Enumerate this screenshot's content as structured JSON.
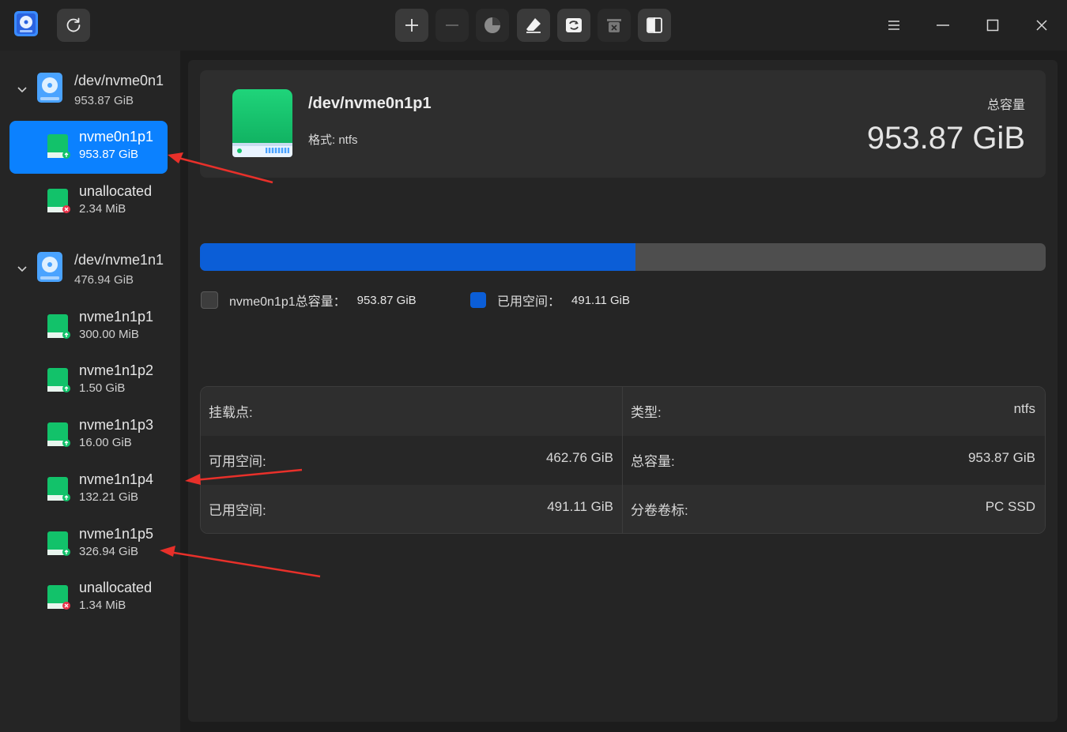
{
  "toolbar": {
    "tools": [
      {
        "name": "create-partition",
        "icon": "plus-icon",
        "enabled": true
      },
      {
        "name": "delete-partition",
        "icon": "minus-icon",
        "enabled": false
      },
      {
        "name": "resize-partition",
        "icon": "pie-chart-icon",
        "enabled": false
      },
      {
        "name": "format-partition",
        "icon": "eraser-icon",
        "enabled": true
      },
      {
        "name": "mount-partition",
        "icon": "drive-sync-icon",
        "enabled": true
      },
      {
        "name": "unmount-partition",
        "icon": "trash-drive-icon",
        "enabled": false
      },
      {
        "name": "disk-info",
        "icon": "split-panel-icon",
        "enabled": true
      }
    ]
  },
  "sidebar": {
    "disks": [
      {
        "name": "/dev/nvme0n1",
        "size": "953.87 GiB",
        "partitions": [
          {
            "name": "nvme0n1p1",
            "size": "953.87 GiB",
            "status": "ok",
            "selected": true
          },
          {
            "name": "unallocated",
            "size": "2.34 MiB",
            "status": "unallocated",
            "selected": false
          }
        ]
      },
      {
        "name": "/dev/nvme1n1",
        "size": "476.94 GiB",
        "partitions": [
          {
            "name": "nvme1n1p1",
            "size": "300.00 MiB",
            "status": "ok",
            "selected": false
          },
          {
            "name": "nvme1n1p2",
            "size": "1.50 GiB",
            "status": "ok",
            "selected": false
          },
          {
            "name": "nvme1n1p3",
            "size": "16.00 GiB",
            "status": "ok",
            "selected": false
          },
          {
            "name": "nvme1n1p4",
            "size": "132.21 GiB",
            "status": "ok",
            "selected": false
          },
          {
            "name": "nvme1n1p5",
            "size": "326.94 GiB",
            "status": "ok",
            "selected": false
          },
          {
            "name": "unallocated",
            "size": "1.34 MiB",
            "status": "unallocated",
            "selected": false
          }
        ]
      }
    ]
  },
  "header": {
    "partition": "/dev/nvme0n1p1",
    "format": "格式: ntfs",
    "capacity_label": "总容量",
    "capacity_value": "953.87 GiB"
  },
  "usage": {
    "used_fraction": 0.5148,
    "legend_total_label": "nvme0n1p1总容量：",
    "legend_total_value": "953.87 GiB",
    "legend_used_label": "已用空间：",
    "legend_used_value": "491.11 GiB",
    "used_color": "#0b5ed7",
    "free_color": "#4e4e4e"
  },
  "info": {
    "mount_label": "挂载点:",
    "mount_value": "",
    "type_label": "类型:",
    "type_value": "ntfs",
    "free_label": "可用空间:",
    "free_value": "462.76 GiB",
    "total_label": "总容量:",
    "total_value": "953.87 GiB",
    "used_label": "已用空间:",
    "used_value": "491.11 GiB",
    "volume_label": "分卷卷标:",
    "volume_value": "PC SSD"
  },
  "colors": {
    "accent": "#0b81ff",
    "arrow": "#e8302a",
    "drive_green": "#12c26a"
  }
}
